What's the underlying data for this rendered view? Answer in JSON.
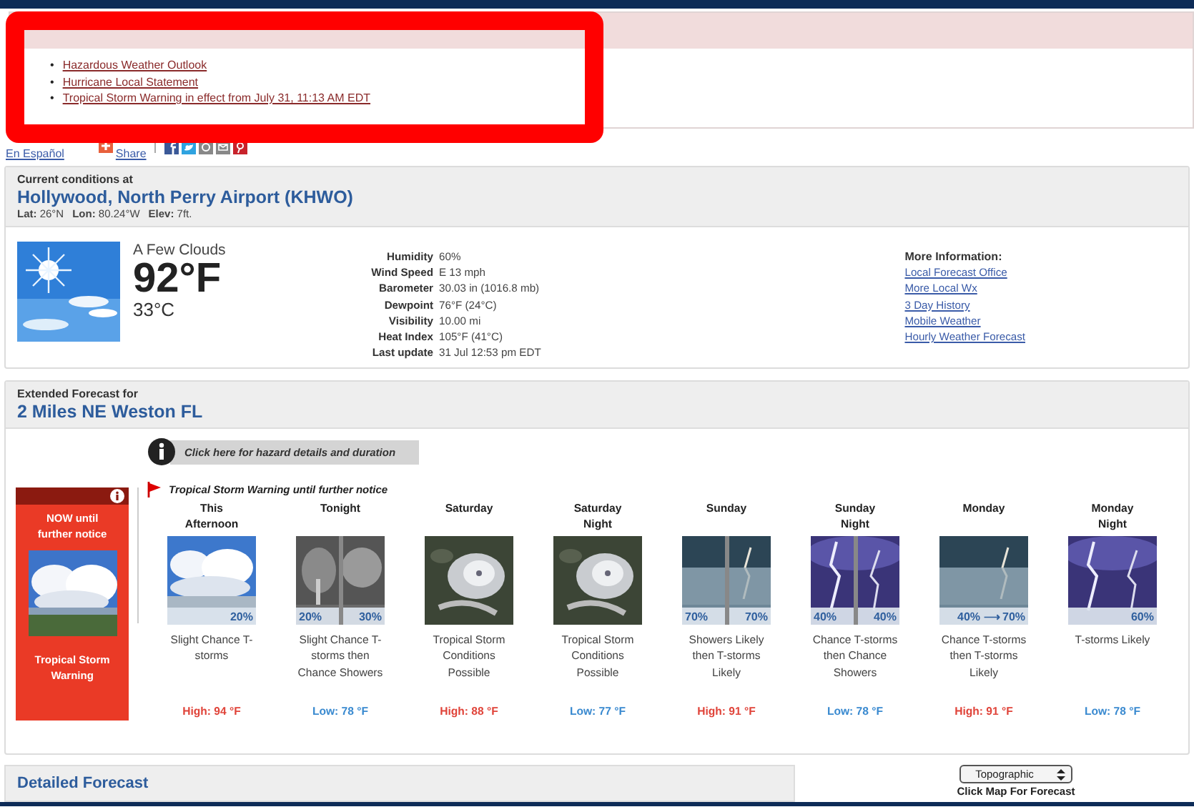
{
  "hazards": {
    "bullet": "•",
    "items": [
      "Hazardous Weather Outlook",
      "Hurricane Local Statement",
      "Tropical Storm Warning in effect from July 31, 11:13 AM EDT"
    ]
  },
  "language_link": "En Español",
  "share": {
    "label": "Share"
  },
  "current": {
    "heading": "Current conditions at",
    "station": "Hollywood, North Perry Airport (KHWO)",
    "coords": [
      {
        "label": "Lat:",
        "value": "26°N"
      },
      {
        "label": "Lon:",
        "value": "80.24°W"
      },
      {
        "label": "Elev:",
        "value": "7ft."
      }
    ],
    "summary": "A Few Clouds",
    "temp_f": "92°F",
    "temp_c": "33°C",
    "details": [
      {
        "label": "Humidity",
        "value": "60%"
      },
      {
        "label": "Wind Speed",
        "value": "E 13 mph"
      },
      {
        "label": "Barometer",
        "value": "30.03 in (1016.8 mb)"
      },
      {
        "label": "Dewpoint",
        "value": "76°F (24°C)"
      },
      {
        "label": "Visibility",
        "value": "10.00 mi"
      },
      {
        "label": "Heat Index",
        "value": "105°F (41°C)"
      },
      {
        "label": "Last update",
        "value": "31 Jul 12:53 pm EDT"
      }
    ],
    "more_info": {
      "title": "More Information:",
      "links": [
        "Local Forecast Office",
        "More Local Wx",
        "3 Day History",
        "Mobile Weather",
        "Hourly Weather Forecast"
      ]
    }
  },
  "extended": {
    "heading": "Extended Forecast for",
    "location": "2 Miles NE Weston FL",
    "hazard_link": "Click here for hazard details and duration",
    "warning_note": "Tropical Storm Warning until further notice",
    "hazard_box": {
      "when": "NOW until further notice",
      "name": "Tropical Storm Warning"
    },
    "periods": [
      {
        "name": "This Afternoon",
        "chances": [
          "20%"
        ],
        "summary": "Slight Chance T-storms",
        "temp": "High: 94 °F",
        "kind": "high"
      },
      {
        "name": "Tonight",
        "chances": [
          "20%",
          "30%"
        ],
        "summary": "Slight Chance T-storms then Chance Showers",
        "temp": "Low: 78 °F",
        "kind": "low"
      },
      {
        "name": "Saturday",
        "summary": "Tropical Storm Conditions Possible",
        "temp": "High: 88 °F",
        "kind": "high"
      },
      {
        "name": "Saturday Night",
        "summary": "Tropical Storm Conditions Possible",
        "temp": "Low: 77 °F",
        "kind": "low"
      },
      {
        "name": "Sunday",
        "chances": [
          "70%",
          "70%"
        ],
        "summary": "Showers Likely then T-storms Likely",
        "temp": "High: 91 °F",
        "kind": "high"
      },
      {
        "name": "Sunday Night",
        "chances": [
          "40%",
          "40%"
        ],
        "summary": "Chance T-storms then Chance Showers",
        "temp": "Low: 78 °F",
        "kind": "low"
      },
      {
        "name": "Monday",
        "chances": [
          "40% ⟶ 70%"
        ],
        "summary": "Chance T-storms then T-storms Likely",
        "temp": "High: 91 °F",
        "kind": "high"
      },
      {
        "name": "Monday Night",
        "chances": [
          "60%"
        ],
        "summary": "T-storms Likely",
        "temp": "Low: 78 °F",
        "kind": "low"
      }
    ]
  },
  "detailed": {
    "heading": "Detailed Forecast"
  },
  "map": {
    "layer": "Topographic",
    "caption": "Click Map For Forecast"
  }
}
